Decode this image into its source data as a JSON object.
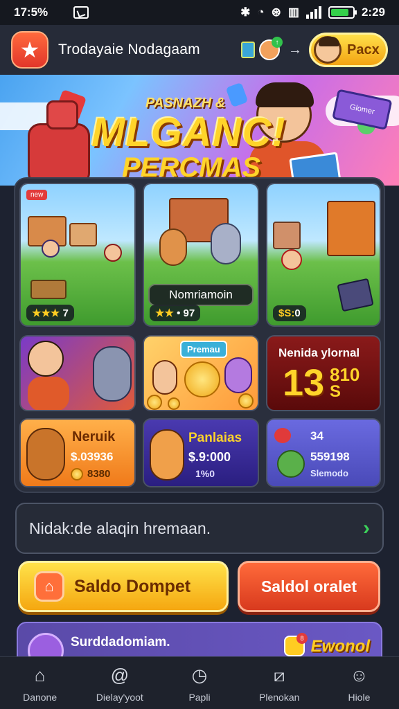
{
  "status_bar": {
    "time": "17:5%",
    "clock": "2:29",
    "battery_pct": 85
  },
  "header": {
    "title": "Trodayaie Nodagaam",
    "play_label": "Pacx"
  },
  "banner": {
    "subtitle": "PASNAZH &",
    "headline": "MLGANC!",
    "headline2": "PERCMAS",
    "sign_text": "Glomer"
  },
  "tiles": [
    {
      "tag": "new",
      "rating_stars": "★★★",
      "rating_value": "7"
    },
    {
      "label": "Nomriamoin",
      "rating_stars": "★★",
      "rating_value": "97"
    },
    {
      "rating_prefix": "$S:",
      "rating_value": "0"
    },
    {},
    {
      "badge": "Premau"
    },
    {
      "title": "Nenida ylornal",
      "big_number": "13",
      "big_suffix": "810",
      "big_small": "S"
    },
    {
      "title": "Neruik",
      "price": "$.03936",
      "coins": "8380"
    },
    {
      "title": "Panlaias",
      "price": "$.9:000",
      "coins": "1%0"
    },
    {
      "count": "34",
      "price": "559198",
      "sub": "Slemodo"
    }
  ],
  "search": {
    "placeholder": "Nidak:de alaqin hremaan."
  },
  "actions": {
    "primary_label": "Saldo Dompet",
    "secondary_label": "Saldol oralet"
  },
  "notice": {
    "text": "Surddadomiam.",
    "badge": "Ewonol",
    "badge_count": "8"
  },
  "nav": [
    {
      "label": "Danone",
      "icon": "home-icon"
    },
    {
      "label": "Dielay'yoot",
      "icon": "at-icon"
    },
    {
      "label": "Papli",
      "icon": "clock-icon"
    },
    {
      "label": "Plenokan",
      "icon": "ticket-icon"
    },
    {
      "label": "Hiole",
      "icon": "profile-icon"
    }
  ],
  "colors": {
    "accent_yellow": "#ffd42a",
    "accent_orange": "#e2362a",
    "success": "#3cd05a",
    "bg": "#1d2230"
  }
}
